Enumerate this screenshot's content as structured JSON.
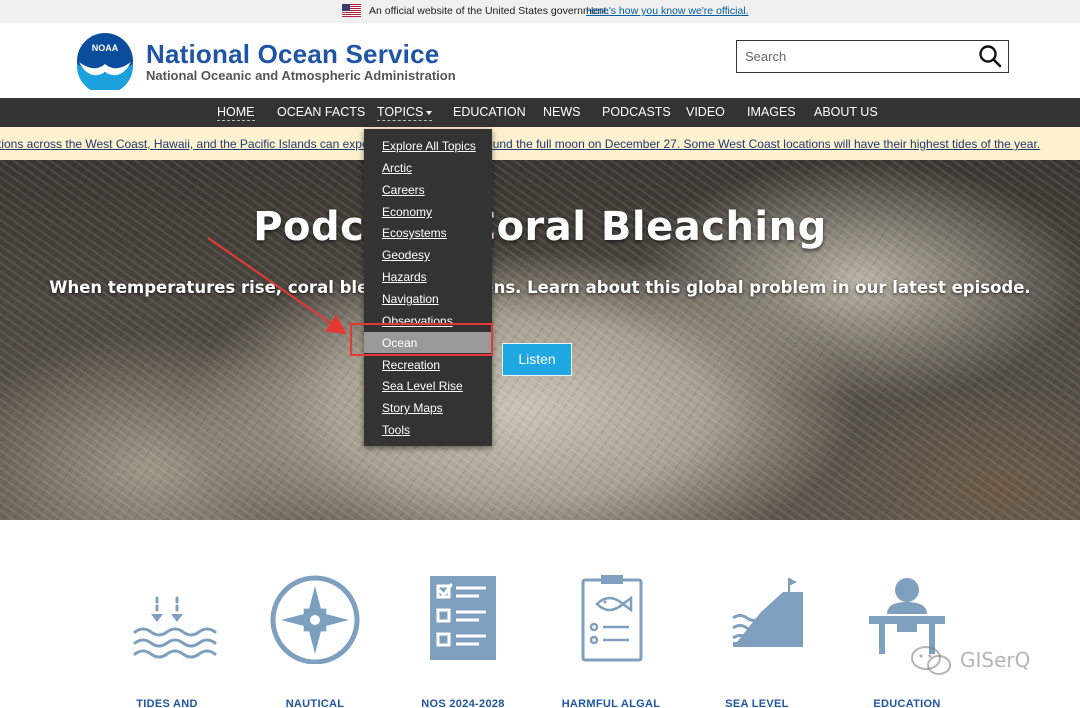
{
  "gov_banner": {
    "text": "An official website of the United States government.",
    "link": "Here's how you know we're official."
  },
  "header": {
    "title": "National Ocean Service",
    "subtitle": "National Oceanic and Atmospheric Administration",
    "logo_text": "NOAA",
    "search_placeholder": "Search"
  },
  "nav": {
    "items": [
      {
        "label": "HOME"
      },
      {
        "label": "OCEAN FACTS"
      },
      {
        "label": "TOPICS"
      },
      {
        "label": "EDUCATION"
      },
      {
        "label": "NEWS"
      },
      {
        "label": "PODCASTS"
      },
      {
        "label": "VIDEO"
      },
      {
        "label": "IMAGES"
      },
      {
        "label": "ABOUT US"
      }
    ]
  },
  "alert": {
    "text": "tions across the West Coast, Hawaii, and the Pacific Islands can expect king tides on and around the full moon on December 27. Some West Coast locations will have their highest tides of the year."
  },
  "hero": {
    "title": "Podcast: Coral Bleaching",
    "subtitle": "When temperatures rise, coral bleaching happens. Learn about this global problem in our latest episode.",
    "button": "Listen"
  },
  "topics_menu": {
    "items": [
      {
        "label": "Explore All Topics"
      },
      {
        "label": "Arctic"
      },
      {
        "label": "Careers"
      },
      {
        "label": "Economy"
      },
      {
        "label": "Ecosystems"
      },
      {
        "label": "Geodesy"
      },
      {
        "label": "Hazards"
      },
      {
        "label": "Navigation"
      },
      {
        "label": "Observations"
      },
      {
        "label": "Ocean"
      },
      {
        "label": "Recreation"
      },
      {
        "label": "Sea Level Rise"
      },
      {
        "label": "Story Maps"
      },
      {
        "label": "Tools"
      }
    ],
    "hovered": "Ocean"
  },
  "features": [
    {
      "label": "TIDES AND",
      "icon": "tides-icon"
    },
    {
      "label": "NAUTICAL",
      "icon": "compass-icon"
    },
    {
      "label": "NOS 2024-2028",
      "icon": "checklist-icon"
    },
    {
      "label": "HARMFUL ALGAL",
      "icon": "clipboard-fish-icon"
    },
    {
      "label": "SEA LEVEL",
      "icon": "sea-level-icon"
    },
    {
      "label": "EDUCATION",
      "icon": "teacher-icon"
    }
  ],
  "watermark": "GISerQ",
  "colors": {
    "brand_blue": "#1f55a4",
    "nav_bg": "#333333",
    "alert_bg": "#fdf1cf",
    "listen_btn": "#1ea7e1",
    "icon_gray_blue": "#7f9fbf",
    "highlight_red": "#e53935"
  }
}
